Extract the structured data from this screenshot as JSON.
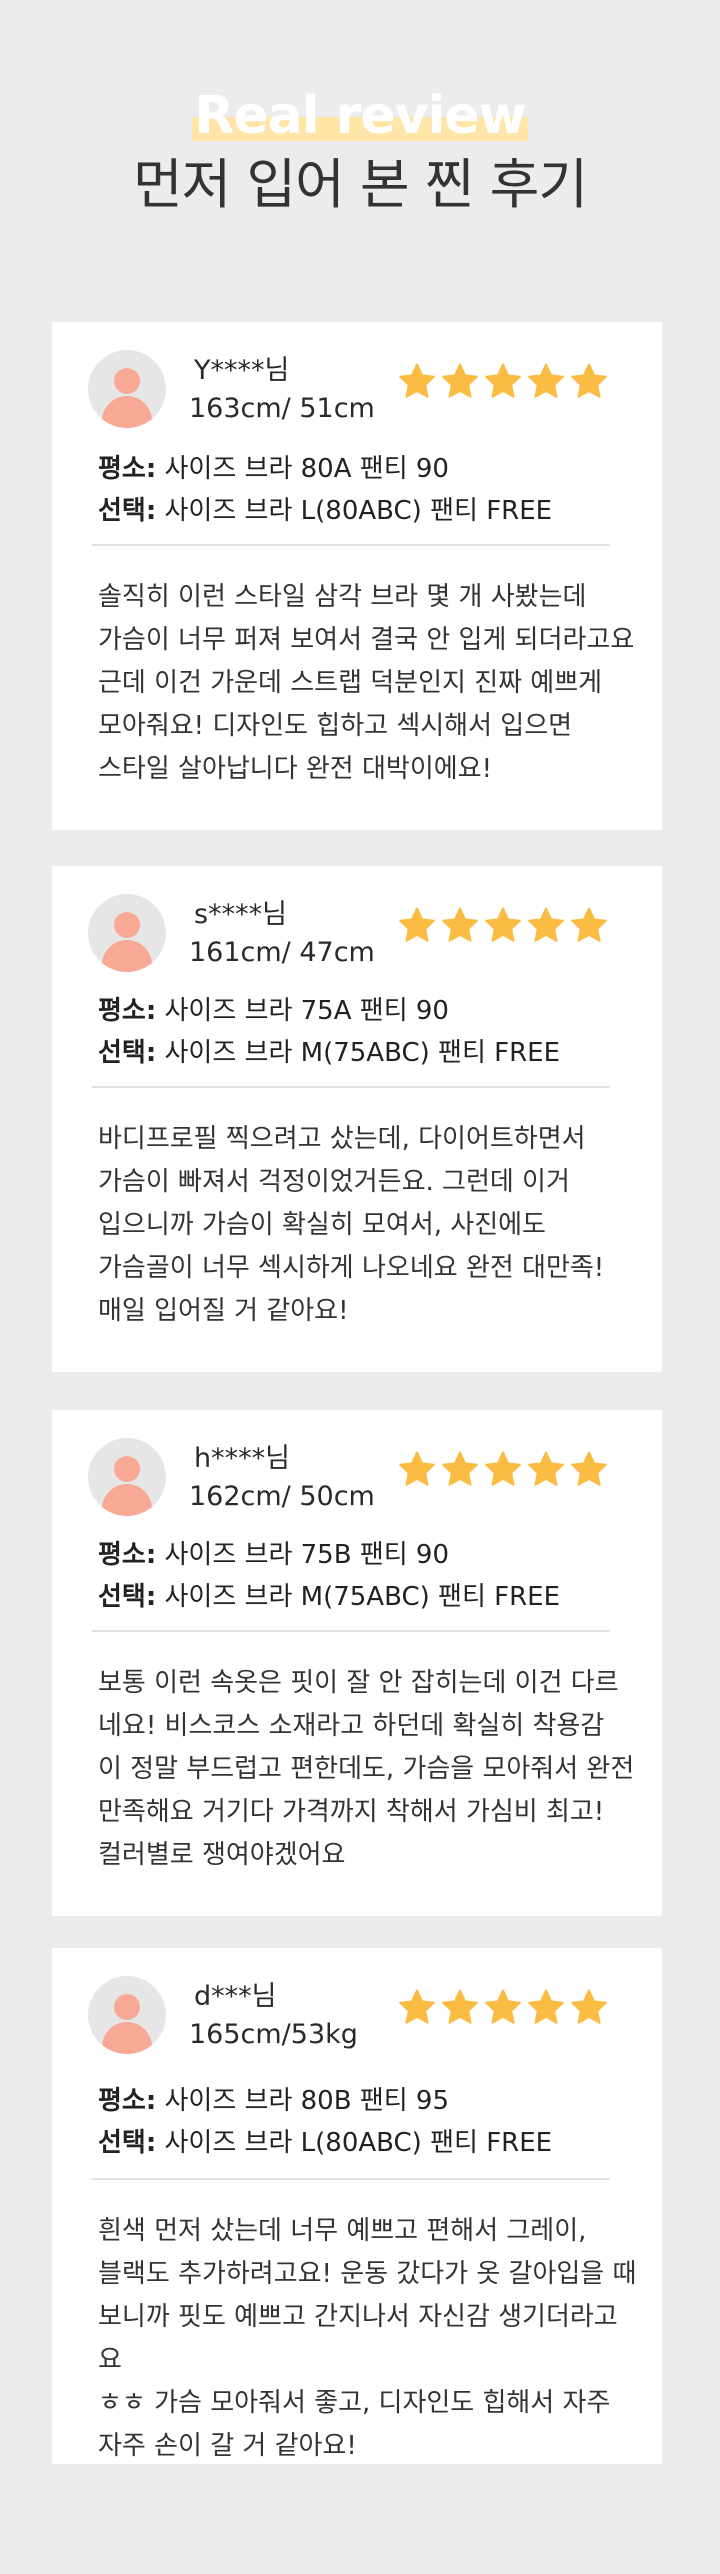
{
  "header": {
    "title_en": "Real review",
    "title_ko": "먼저 입어 본 찐 후기"
  },
  "colors": {
    "background": "#ececec",
    "star": "#fbbc44",
    "avatar": "#f8a996",
    "highlight": "#ffe6a8"
  },
  "reviews": [
    {
      "user": "Y****님",
      "size": "163cm/ 51cm",
      "rating": 5,
      "usual_label": "평소:",
      "usual_value": "사이즈 브라 80A 팬티 90",
      "choice_label": "선택:",
      "choice_value": "사이즈 브라 L(80ABC) 팬티 FREE",
      "text": "솔직히 이런 스타일 삼각 브라 몇 개 사봤는데\n가슴이 너무 퍼져 보여서 결국 안 입게 되더라고요\n근데 이건 가운데 스트랩 덕분인지 진짜 예쁘게\n모아줘요! 디자인도 힙하고 섹시해서 입으면\n스타일 살아납니다 완전 대박이에요!"
    },
    {
      "user": "s****님",
      "size": "161cm/ 47cm",
      "rating": 5,
      "usual_label": "평소:",
      "usual_value": "사이즈 브라 75A 팬티 90",
      "choice_label": "선택:",
      "choice_value": "사이즈 브라 M(75ABC) 팬티 FREE",
      "text": "바디프로필 찍으려고 샀는데, 다이어트하면서\n가슴이 빠져서 걱정이었거든요. 그런데 이거\n입으니까 가슴이 확실히 모여서, 사진에도\n가슴골이 너무 섹시하게 나오네요 완전 대만족!\n매일 입어질 거 같아요!"
    },
    {
      "user": "h****님",
      "size": "162cm/ 50cm",
      "rating": 5,
      "usual_label": "평소:",
      "usual_value": "사이즈 브라 75B 팬티 90",
      "choice_label": "선택:",
      "choice_value": "사이즈 브라 M(75ABC) 팬티 FREE",
      "text": "보통 이런 속옷은 핏이 잘 안 잡히는데 이건 다르\n네요! 비스코스 소재라고 하던데 확실히 착용감\n이 정말 부드럽고 편한데도, 가슴을 모아줘서 완전\n만족해요 거기다 가격까지 착해서 가심비 최고!\n컬러별로 쟁여야겠어요"
    },
    {
      "user": "d***님",
      "size": "165cm/53kg",
      "rating": 5,
      "usual_label": "평소:",
      "usual_value": "사이즈 브라 80B 팬티 95",
      "choice_label": "선택:",
      "choice_value": "사이즈 브라 L(80ABC) 팬티 FREE",
      "text": "흰색 먼저 샀는데 너무 예쁘고 편해서 그레이,\n블랙도 추가하려고요! 운동 갔다가 옷 갈아입을 때\n보니까 핏도 예쁘고 간지나서 자신감 생기더라고요\nㅎㅎ 가슴 모아줘서 좋고, 디자인도 힙해서 자주\n자주 손이 갈 거 같아요!"
    }
  ]
}
